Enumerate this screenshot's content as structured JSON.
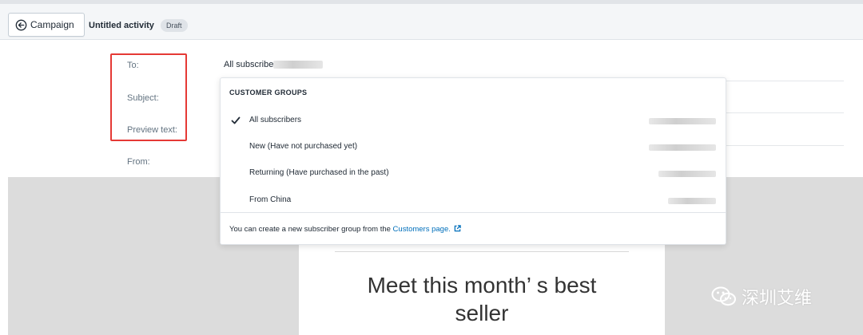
{
  "toolbar": {
    "back_label": "Campaign",
    "activity_title": "Untitled activity",
    "status_badge": "Draft"
  },
  "form": {
    "to_label": "To:",
    "to_value": "All subscribe",
    "subject_label": "Subject:",
    "preview_label": "Preview text:",
    "from_label": "From:"
  },
  "dropdown": {
    "header": "CUSTOMER GROUPS",
    "options": [
      {
        "label": "All subscribers",
        "selected": true
      },
      {
        "label": "New (Have not purchased yet)",
        "selected": false
      },
      {
        "label": "Returning (Have purchased in the past)",
        "selected": false
      },
      {
        "label": "From China",
        "selected": false
      }
    ],
    "footer_text": "You can create a new subscriber group from the",
    "footer_link": "Customers page."
  },
  "email_preview": {
    "heading_line1": "Meet this month’ s best",
    "heading_line2": "seller"
  },
  "watermark": {
    "text": "深圳艾维"
  },
  "colors": {
    "highlight": "#e53935",
    "link": "#006fbb",
    "canvas": "#dcdcdc"
  },
  "icons": {
    "back": "circle-arrow-left-icon",
    "check": "checkmark-icon",
    "external": "external-link-icon",
    "watermark": "wechat-icon"
  }
}
